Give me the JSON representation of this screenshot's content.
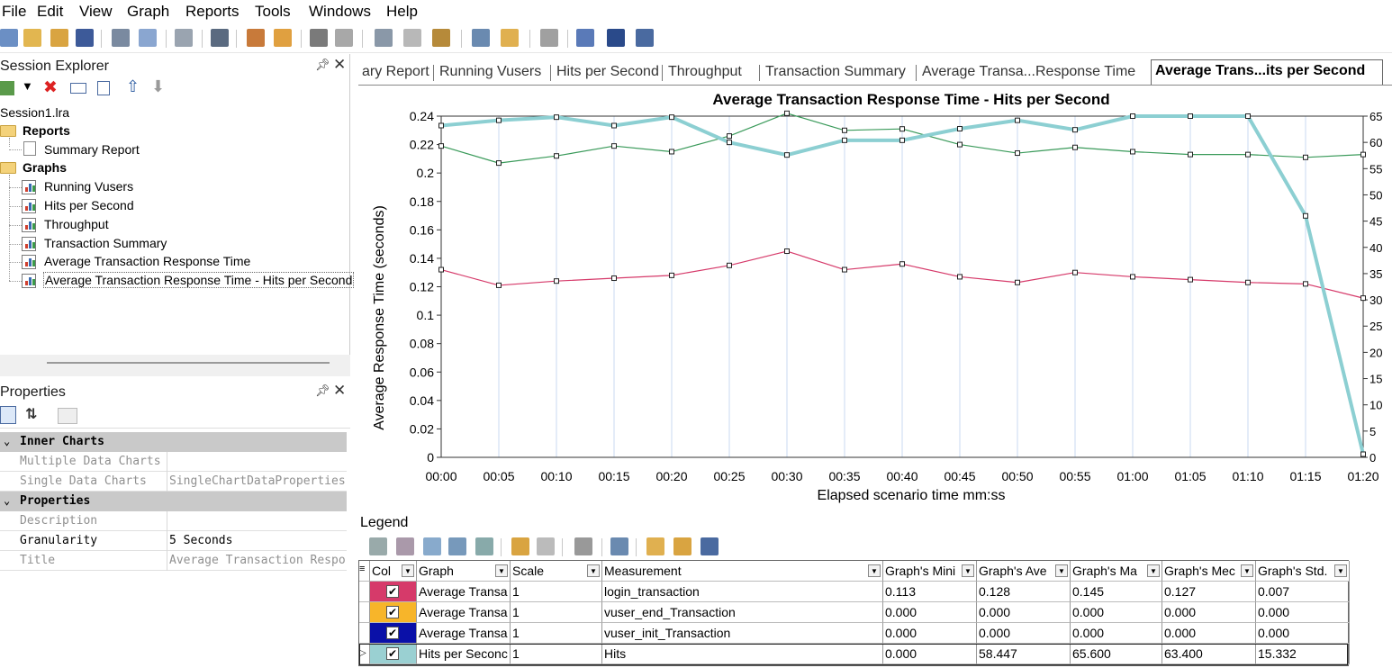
{
  "menu": [
    "File",
    "Edit",
    "View",
    "Graph",
    "Reports",
    "Tools",
    "Windows",
    "Help"
  ],
  "explorer": {
    "title": "Session Explorer",
    "root": "Session1.lra",
    "reports_label": "Reports",
    "summary_report": "Summary Report",
    "graphs_label": "Graphs",
    "graphs": [
      "Running Vusers",
      "Hits per Second",
      "Throughput",
      "Transaction Summary",
      "Average Transaction Response Time",
      "Average Transaction Response Time - Hits per Second"
    ]
  },
  "properties": {
    "title": "Properties",
    "rows": [
      {
        "type": "cat",
        "name": "Inner Charts"
      },
      {
        "type": "prop",
        "name": "Multiple Data Charts",
        "value": "",
        "gray": true
      },
      {
        "type": "prop",
        "name": "Single Data Charts",
        "value": "SingleChartDataProperties",
        "gray": true
      },
      {
        "type": "cat",
        "name": "Properties"
      },
      {
        "type": "prop",
        "name": "Description",
        "value": "",
        "gray": true
      },
      {
        "type": "prop",
        "name": "Granularity",
        "value": "5 Seconds",
        "gray": false
      },
      {
        "type": "prop",
        "name": "Title",
        "value": "Average Transaction Respo",
        "gray": true
      }
    ]
  },
  "tabs": [
    "ary Report",
    "Running Vusers",
    "Hits per Second",
    "Throughput",
    "Transaction Summary",
    "Average Transa...Response Time",
    "Average Trans...its per Second"
  ],
  "active_tab": 6,
  "legend": {
    "title": "Legend",
    "columns": [
      "Col",
      "Graph",
      "Scale",
      "Measurement",
      "Graph's Mini",
      "Graph's Ave",
      "Graph's Ma",
      "Graph's Mec",
      "Graph's Std."
    ],
    "rows": [
      {
        "color": "#d63a6a",
        "graph": "Average Transa",
        "scale": "1",
        "measurement": "login_transaction",
        "min": "0.113",
        "avg": "0.128",
        "max": "0.145",
        "med": "0.127",
        "std": "0.007"
      },
      {
        "color": "#f7b52a",
        "graph": "Average Transa",
        "scale": "1",
        "measurement": "vuser_end_Transaction",
        "min": "0.000",
        "avg": "0.000",
        "max": "0.000",
        "med": "0.000",
        "std": "0.000"
      },
      {
        "color": "#0a10a8",
        "graph": "Average Transa",
        "scale": "1",
        "measurement": "vuser_init_Transaction",
        "min": "0.000",
        "avg": "0.000",
        "max": "0.000",
        "med": "0.000",
        "std": "0.000"
      },
      {
        "color": "#9ad0d2",
        "graph": "Hits per Seconc",
        "scale": "1",
        "measurement": "Hits",
        "min": "0.000",
        "avg": "58.447",
        "max": "65.600",
        "med": "63.400",
        "std": "15.332"
      }
    ]
  },
  "chart_data": {
    "type": "line",
    "title": "Average Transaction Response Time - Hits per Second",
    "xlabel": "Elapsed scenario time mm:ss",
    "ylabel": "Average Response Time (seconds)",
    "ylim": [
      0,
      0.24
    ],
    "y2lim": [
      0,
      65
    ],
    "yticks": [
      "0",
      "0.02",
      "0.04",
      "0.06",
      "0.08",
      "0.1",
      "0.12",
      "0.14",
      "0.16",
      "0.18",
      "0.2",
      "0.22",
      "0.24"
    ],
    "y2ticks": [
      "0",
      "5",
      "10",
      "15",
      "20",
      "25",
      "30",
      "35",
      "40",
      "45",
      "50",
      "55",
      "60",
      "65"
    ],
    "categories": [
      "00:00",
      "00:05",
      "00:10",
      "00:15",
      "00:20",
      "00:25",
      "00:30",
      "00:35",
      "00:40",
      "00:45",
      "00:50",
      "00:55",
      "01:00",
      "01:05",
      "01:10",
      "01:15",
      "01:20"
    ],
    "grid": true,
    "series": [
      {
        "name": "login_transaction",
        "color": "#d63a6a",
        "axis": "left",
        "width": 1.2,
        "values": [
          0.132,
          0.121,
          0.124,
          0.126,
          0.128,
          0.135,
          0.145,
          0.132,
          0.136,
          0.127,
          0.123,
          0.13,
          0.127,
          0.125,
          0.123,
          0.122,
          0.112
        ]
      },
      {
        "name": "vuser_end_Transaction",
        "color": "#3a9a5a",
        "axis": "left",
        "width": 1.2,
        "values": [
          0.219,
          0.207,
          0.212,
          0.219,
          0.215,
          0.226,
          0.242,
          0.23,
          0.231,
          0.22,
          0.214,
          0.218,
          0.215,
          0.213,
          0.213,
          0.211,
          0.213
        ]
      },
      {
        "name": "Hits",
        "color": "#8ccfd2",
        "axis": "right",
        "width": 4,
        "values": [
          63.2,
          64.2,
          64.8,
          63.2,
          64.8,
          60.0,
          57.6,
          60.4,
          60.4,
          62.6,
          64.2,
          62.4,
          65.0,
          65.0,
          65.0,
          46.0,
          0.6
        ]
      }
    ]
  }
}
